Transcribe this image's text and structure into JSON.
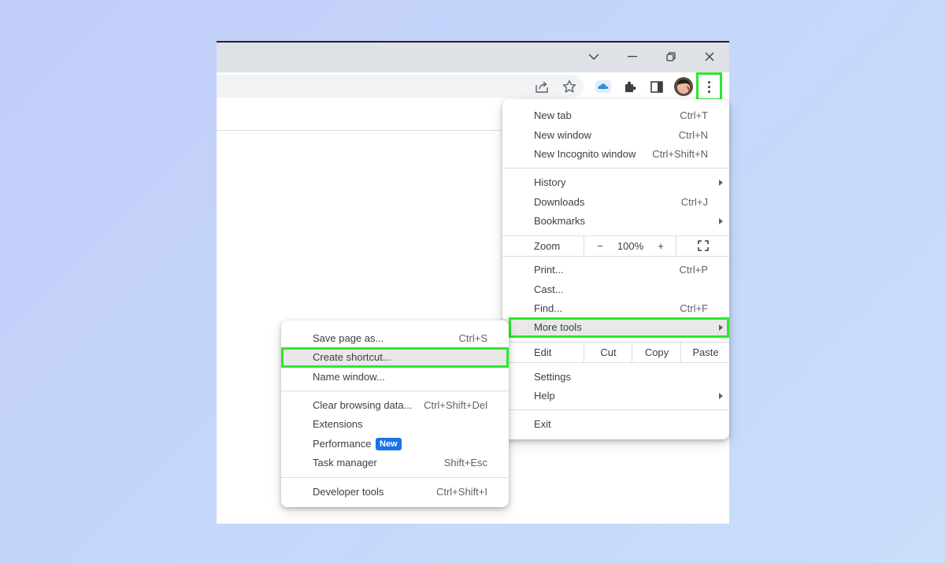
{
  "main_menu": {
    "items": [
      {
        "label": "New tab",
        "shortcut": "Ctrl+T"
      },
      {
        "label": "New window",
        "shortcut": "Ctrl+N"
      },
      {
        "label": "New Incognito window",
        "shortcut": "Ctrl+Shift+N"
      },
      {
        "label": "History",
        "shortcut": ""
      },
      {
        "label": "Downloads",
        "shortcut": "Ctrl+J"
      },
      {
        "label": "Bookmarks",
        "shortcut": ""
      },
      {
        "label": "Print...",
        "shortcut": "Ctrl+P"
      },
      {
        "label": "Cast...",
        "shortcut": ""
      },
      {
        "label": "Find...",
        "shortcut": "Ctrl+F"
      },
      {
        "label": "More tools",
        "shortcut": ""
      },
      {
        "label": "Settings",
        "shortcut": ""
      },
      {
        "label": "Help",
        "shortcut": ""
      },
      {
        "label": "Exit",
        "shortcut": ""
      }
    ],
    "zoom": {
      "label": "Zoom",
      "minus": "−",
      "value": "100%",
      "plus": "+"
    },
    "edit": {
      "label": "Edit",
      "cut": "Cut",
      "copy": "Copy",
      "paste": "Paste"
    }
  },
  "sub_menu": {
    "items": [
      {
        "label": "Save page as...",
        "shortcut": "Ctrl+S"
      },
      {
        "label": "Create shortcut...",
        "shortcut": ""
      },
      {
        "label": "Name window...",
        "shortcut": ""
      },
      {
        "label": "Clear browsing data...",
        "shortcut": "Ctrl+Shift+Del"
      },
      {
        "label": "Extensions",
        "shortcut": ""
      },
      {
        "label": "Performance",
        "shortcut": "",
        "badge": "New"
      },
      {
        "label": "Task manager",
        "shortcut": "Shift+Esc"
      },
      {
        "label": "Developer tools",
        "shortcut": "Ctrl+Shift+I"
      }
    ]
  },
  "icons": {
    "titlebar": [
      "tab-search-icon",
      "minimize-icon",
      "restore-icon",
      "close-icon"
    ],
    "toolbar": [
      "share-icon",
      "bookmark-star-icon",
      "cloud-extension-icon",
      "extensions-puzzle-icon",
      "side-panel-icon",
      "profile-avatar",
      "kebab-menu-icon"
    ]
  },
  "colors": {
    "highlight": "#2ee82e",
    "badge": "#1a73e8",
    "hover_row": "#e8e8e8"
  }
}
